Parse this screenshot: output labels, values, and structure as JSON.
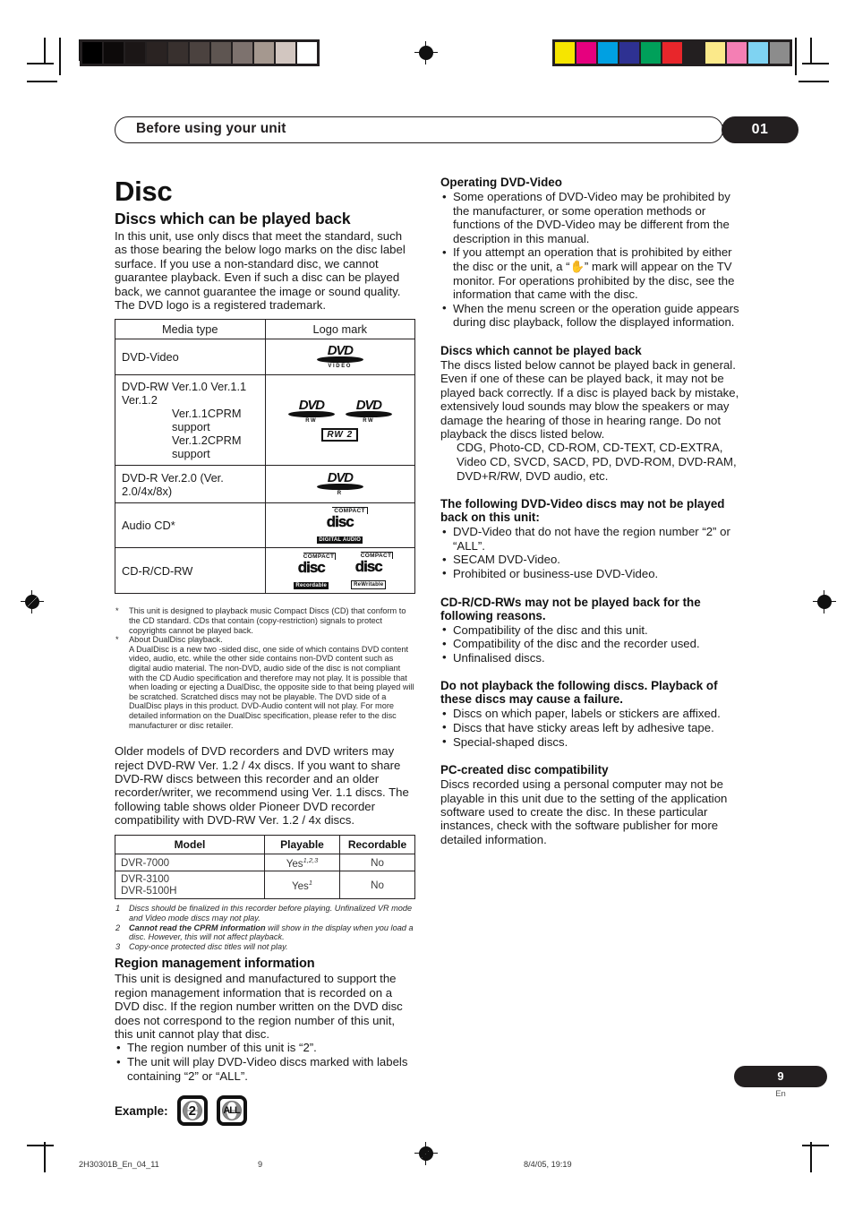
{
  "header": {
    "running_title": "Before using your unit",
    "chapter_badge": "01"
  },
  "left_column": {
    "doc_title": "Disc",
    "section_title": "Discs which can be played back",
    "intro": "In this unit, use only discs that meet the standard, such as those bearing the below logo marks on the disc label surface. If you use a non-standard disc, we cannot guarantee playback. Even if such a disc can be played back, we cannot guarantee the image or sound quality.",
    "trademark_note": "The DVD logo is a registered trademark.",
    "media_table": {
      "headers": [
        "Media type",
        "Logo mark"
      ],
      "rows": [
        {
          "media": "DVD-Video",
          "media_lines": [
            "DVD-Video"
          ],
          "logos": [
            "dvd-video-logo"
          ]
        },
        {
          "media": "DVD-RW Ver.1.0 Ver.1.1 Ver.1.2 Ver.1.1CPRM support Ver.1.2CPRM support",
          "media_lines": [
            "DVD-RW  Ver.1.0 Ver.1.1 Ver.1.2",
            "Ver.1.1CPRM support",
            "Ver.1.2CPRM support"
          ],
          "logos": [
            "dvd-rw-logo",
            "dvd-rw-logo",
            "rw2-logo"
          ]
        },
        {
          "media": "DVD-R Ver.2.0 (Ver. 2.0/4x/8x)",
          "media_lines": [
            "DVD-R Ver.2.0 (Ver. 2.0/4x/8x)"
          ],
          "logos": [
            "dvd-r-logo"
          ]
        },
        {
          "media": "Audio CD*",
          "media_lines": [
            "Audio CD*"
          ],
          "logos": [
            "compact-disc-digital-audio-logo"
          ]
        },
        {
          "media": "CD-R/CD-RW",
          "media_lines": [
            "CD-R/CD-RW"
          ],
          "logos": [
            "compact-disc-recordable-logo",
            "compact-disc-rewritable-logo"
          ]
        }
      ]
    },
    "logo_text": {
      "dvd_word": "DVD",
      "video_sub": "VIDEO",
      "rw_sub": "RW",
      "r_sub": "R",
      "rw2_label": "RW 2",
      "compact_label": "COMPACT",
      "disc_word": "disc",
      "digital_audio_label": "DIGITAL AUDIO",
      "recordable_label": "Recordable",
      "rewritable_label": "ReWritable"
    },
    "footnotes_asterisk": [
      {
        "mark": "*",
        "text": "This unit is designed to playback music Compact Discs (CD) that conform to the CD standard. CDs that contain (copy-restriction) signals to protect copyrights cannot be played back."
      },
      {
        "mark": "*",
        "text": "About DualDisc playback."
      },
      {
        "mark": "",
        "text": "A DualDisc is a new two -sided disc, one side of which contains DVD content video, audio, etc. while the other side contains non-DVD content such as digital audio material. The non-DVD, audio side of the disc is not compliant with the CD Audio specification and therefore may not play. It is possible that when loading or ejecting a DualDisc, the opposite side to that being played will be scratched. Scratched discs may not be playable. The DVD side of a DualDisc plays in this product. DVD-Audio content will not play. For more detailed information on the DualDisc specification, please refer to the disc manufacturer or disc retailer."
      }
    ],
    "older_models_paragraph": "Older models of DVD recorders and DVD writers may reject DVD-RW Ver. 1.2 / 4x discs. If you want to share DVD-RW discs between this recorder and an older recorder/writer, we recommend using Ver. 1.1 discs. The following table shows older Pioneer DVD recorder compatibility with DVD-RW Ver. 1.2 / 4x discs.",
    "model_table": {
      "headers": [
        "Model",
        "Playable",
        "Recordable"
      ],
      "rows": [
        {
          "model_lines": [
            "DVR-7000"
          ],
          "playable": "Yes",
          "playable_refs": "1,2,3",
          "recordable": "No"
        },
        {
          "model_lines": [
            "DVR-3100",
            "DVR-5100H"
          ],
          "playable": "Yes",
          "playable_refs": "1",
          "recordable": "No"
        }
      ]
    },
    "model_footnotes": [
      {
        "num": "1",
        "bold": "",
        "text": "Discs should be finalized in this recorder before playing. Unfinalized VR mode and Video mode discs may not play."
      },
      {
        "num": "2",
        "bold": "Cannot read the CPRM information",
        "text": " will show in the display when you load a disc. However, this will not affect playback."
      },
      {
        "num": "3",
        "bold": "",
        "text": "Copy-once protected disc titles will not play."
      }
    ],
    "region_section": {
      "title": "Region management information",
      "body": "This unit is designed and manufactured to support the region management information that is recorded on a DVD disc. If the region number written on the DVD disc does not correspond to the region number of this unit, this unit cannot play that disc.",
      "bullets": [
        "The region number of this unit is “2”.",
        "The unit will play DVD-Video discs marked with labels containing “2” or “ALL”."
      ],
      "example_label": "Example:",
      "example_icons": [
        "2",
        "ALL"
      ]
    }
  },
  "right_column": {
    "operating_dvd_video": {
      "title": "Operating DVD-Video",
      "bullets": [
        "Some operations of DVD-Video may be prohibited by the manufacturer, or some operation methods or functions of the DVD-Video may be different from the description in this manual.",
        "If you attempt an operation that is prohibited by either the disc or the unit, a “✋” mark will appear on the TV monitor. For operations prohibited by the disc, see the information that came with the disc.",
        "When the menu screen or the operation guide appears during disc playback, follow the displayed information."
      ]
    },
    "cannot_be_played": {
      "title": "Discs which cannot be played back",
      "body": "The discs listed below cannot be played back in general. Even if one of these can be played back, it may not be played back correctly. If a disc is played back by mistake, extensively loud sounds may blow the speakers or may damage the hearing of those in hearing range. Do not playback the discs listed below.",
      "list": "CDG, Photo-CD, CD-ROM, CD-TEXT, CD-EXTRA, Video CD, SVCD, SACD, PD, DVD-ROM, DVD-RAM, DVD+R/RW, DVD audio, etc."
    },
    "dvd_video_not_played": {
      "title": "The following DVD-Video discs may not be played back on this unit:",
      "bullets": [
        "DVD-Video that do not have the region number “2” or “ALL”.",
        "SECAM DVD-Video.",
        "Prohibited or business-use DVD-Video."
      ]
    },
    "cdr_reasons": {
      "title": "CD-R/CD-RWs may not be played back for the following reasons.",
      "bullets": [
        "Compatibility of the disc and this unit.",
        "Compatibility of the disc and the recorder used.",
        "Unfinalised discs."
      ]
    },
    "do_not_playback": {
      "title": "Do not playback the following discs. Playback of these discs may cause a failure.",
      "bullets": [
        "Discs on which paper, labels or stickers are affixed.",
        "Discs that have sticky areas left by adhesive tape.",
        "Special-shaped discs."
      ]
    },
    "pc_created": {
      "title": "PC-created disc compatibility",
      "body": "Discs recorded using a personal computer may not be playable in this unit due to the setting of the application software used to create the disc. In these particular instances, check with the software publisher for more detailed information."
    }
  },
  "page_footer": {
    "page_number": "9",
    "language_code": "En",
    "print_file": "2H30301B_En_04_11",
    "print_page": "9",
    "print_date": "8/4/05, 19:19"
  },
  "calibration": {
    "gray_strip": [
      "#000000",
      "#0d0a0a",
      "#1b1616",
      "#2a2322",
      "#38302e",
      "#4b423f",
      "#5e5551",
      "#7d726e",
      "#a5988f",
      "#d2c6c0",
      "#ffffff"
    ],
    "color_strip": [
      "#f6e500",
      "#e6007e",
      "#00a0e2",
      "#2e3192",
      "#00a05a",
      "#e8262b",
      "#231f20",
      "#fbe98a",
      "#f47fb4",
      "#7fd3f2",
      "#8c8c8c"
    ]
  }
}
